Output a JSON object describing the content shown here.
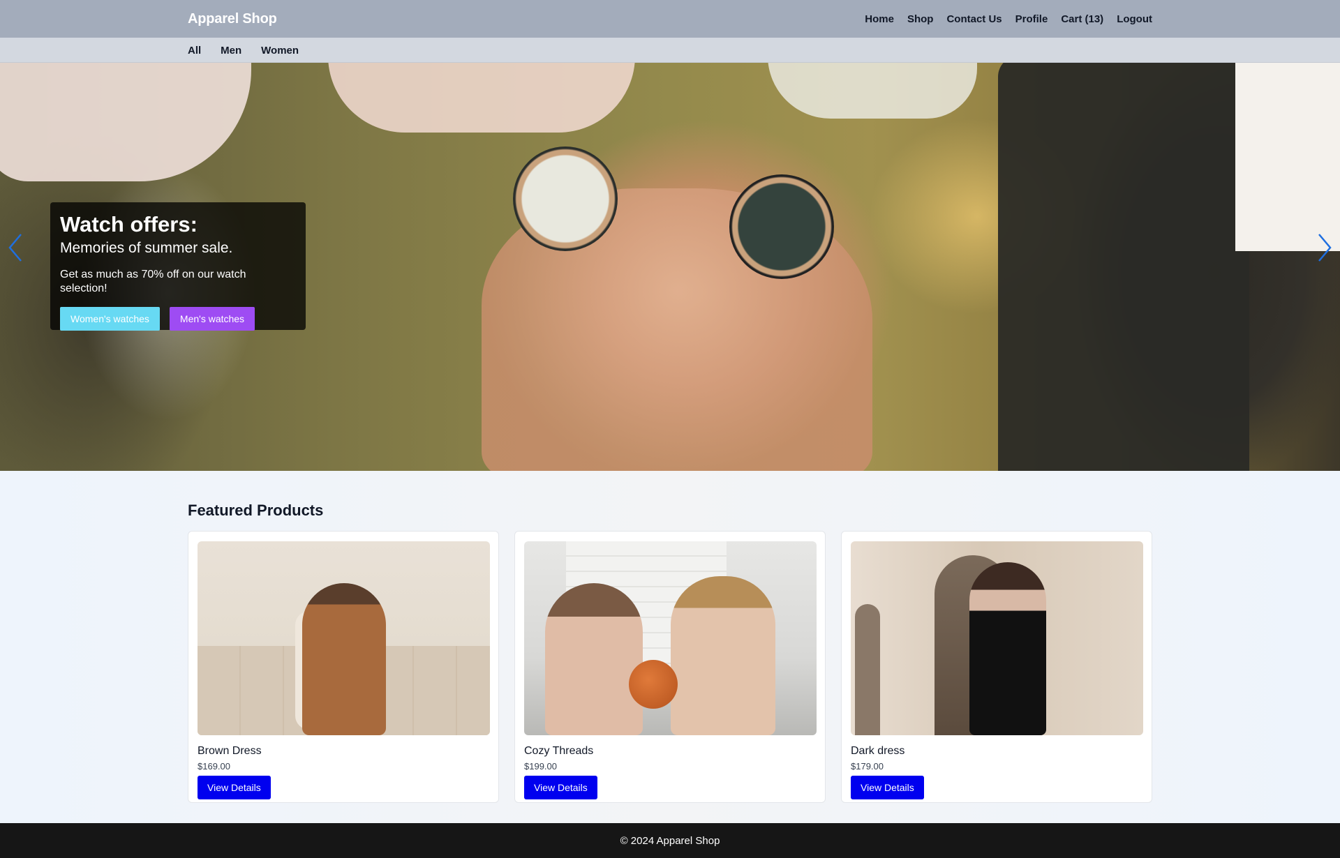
{
  "header": {
    "brand": "Apparel Shop",
    "nav": [
      "Home",
      "Shop",
      "Contact Us",
      "Profile",
      "Cart (13)",
      "Logout"
    ]
  },
  "categories": [
    "All",
    "Men",
    "Women"
  ],
  "hero": {
    "title": "Watch offers:",
    "subtitle": "Memories of summer sale.",
    "text": "Get as much as 70% off on our watch selection!",
    "buttons": [
      "Women's watches",
      "Men's watches"
    ],
    "colors": {
      "womens": "#67d9f3",
      "mens": "#9e4cf3",
      "arrows": "#1f6fe0"
    },
    "icons": {
      "prev": "chevron-left-icon",
      "next": "chevron-right-icon"
    }
  },
  "featured": {
    "title": "Featured Products",
    "products": [
      {
        "name": "Brown Dress",
        "price": "$169.00",
        "button": "View Details"
      },
      {
        "name": "Cozy Threads",
        "price": "$199.00",
        "button": "View Details"
      },
      {
        "name": "Dark dress",
        "price": "$179.00",
        "button": "View Details"
      }
    ],
    "button_color": "#0000ef"
  },
  "footer": {
    "text": "© 2024 Apparel Shop"
  }
}
